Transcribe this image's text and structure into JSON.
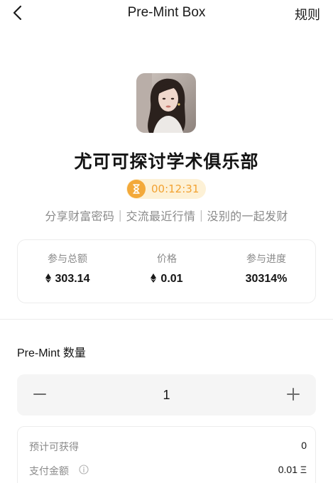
{
  "header": {
    "title": "Pre-Mint Box",
    "rules_label": "规则"
  },
  "club": {
    "name": "尤可可探讨学术俱乐部",
    "countdown": "00:12:31",
    "tagline": "分享财富密码｜交流最近行情｜没别的一起发财"
  },
  "stats": [
    {
      "label": "参与总额",
      "value": "303.14",
      "currency_icon": "eth-icon"
    },
    {
      "label": "价格",
      "value": "0.01",
      "currency_icon": "eth-icon"
    },
    {
      "label": "参与进度",
      "value": "30314%"
    }
  ],
  "quantity": {
    "section_title": "Pre-Mint 数量",
    "value": "1"
  },
  "summary": {
    "estimated_label": "预计可获得",
    "estimated_value": "0",
    "payment_label": "支付金额",
    "payment_value": "0.01 Ξ"
  },
  "colors": {
    "accent": "#f3a93a",
    "timer_bg": "#fdf1d6",
    "muted_text": "#8a8a8a",
    "border": "#ececec"
  }
}
